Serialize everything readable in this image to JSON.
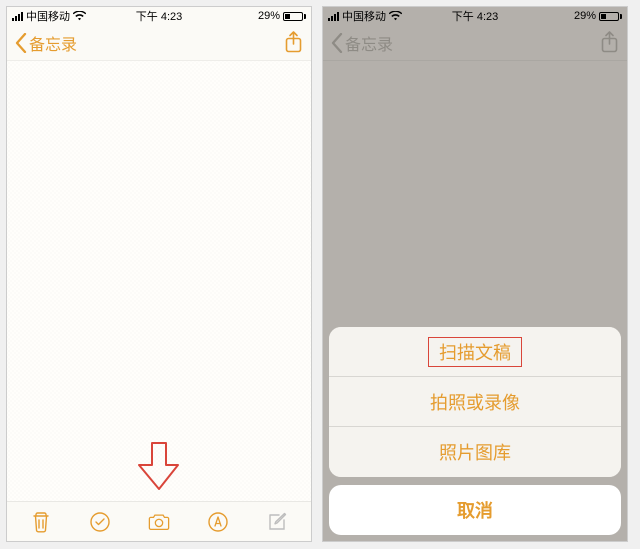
{
  "status": {
    "carrier": "中国移动",
    "time": "下午 4:23",
    "battery_pct": "29%"
  },
  "nav": {
    "back_label": "备忘录"
  },
  "action_sheet": {
    "items": [
      "扫描文稿",
      "拍照或录像",
      "照片图库"
    ],
    "cancel": "取消"
  }
}
